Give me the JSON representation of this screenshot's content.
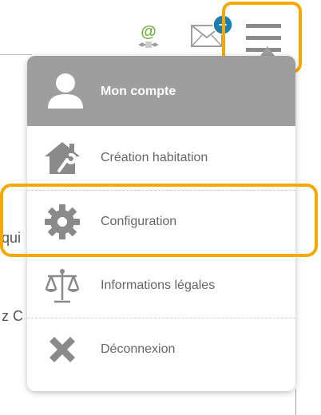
{
  "background": {
    "fragment_1": "qui",
    "fragment_2": "z C"
  },
  "header": {
    "notification_badge": "+"
  },
  "menu": {
    "account_label": "Mon compte",
    "items": [
      {
        "label": "Création habitation",
        "icon": "house-wrench-icon"
      },
      {
        "label": "Configuration",
        "icon": "gear-icon"
      },
      {
        "label": "Informations légales",
        "icon": "scales-icon"
      },
      {
        "label": "Déconnexion",
        "icon": "close-icon"
      }
    ]
  },
  "colors": {
    "highlight": "#f5a800",
    "menu_header": "#9e9e9e",
    "icon_gray": "#8a8a8a",
    "badge": "#1b7fb0",
    "at_green": "#6db33f"
  }
}
